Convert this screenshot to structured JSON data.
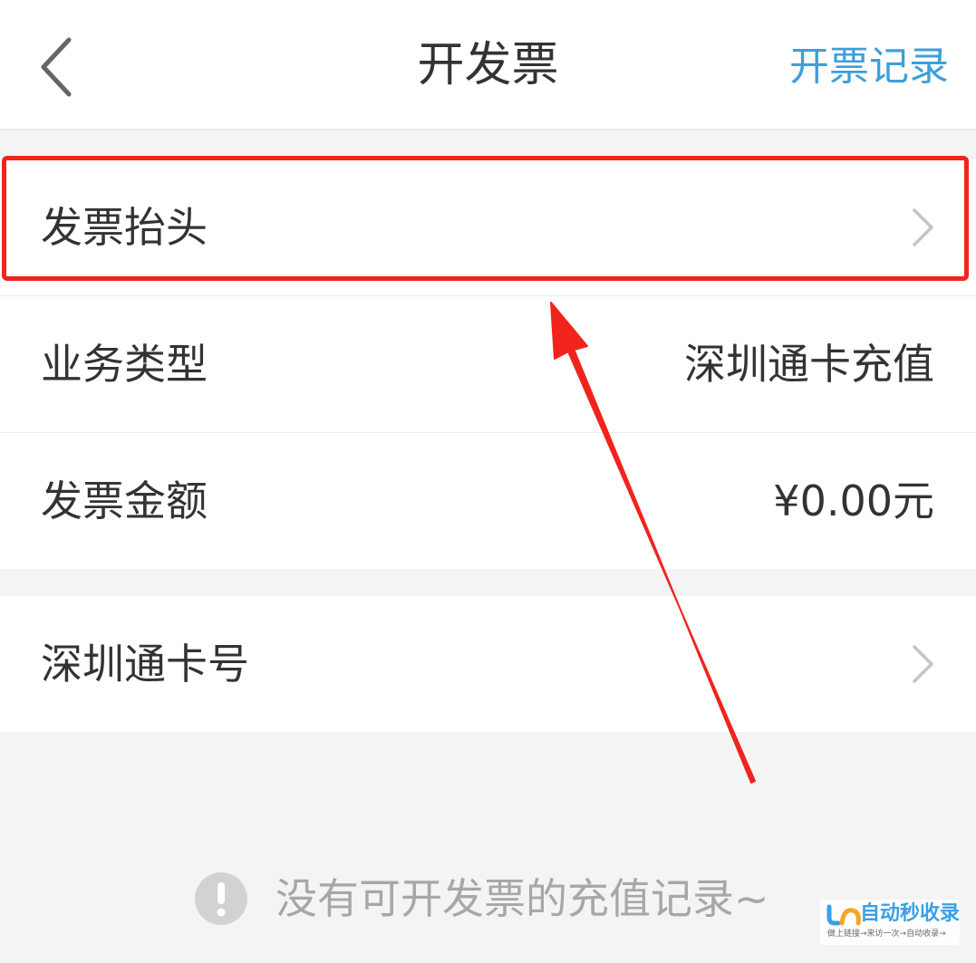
{
  "header": {
    "title": "开发票",
    "action_label": "开票记录"
  },
  "invoice_title_row": {
    "label": "发票抬头"
  },
  "info_rows": [
    {
      "label": "业务类型",
      "value": "深圳通卡充值"
    },
    {
      "label": "发票金额",
      "value": "¥0.00元"
    }
  ],
  "card_row": {
    "label": "深圳通卡号"
  },
  "empty_state": {
    "message": "没有可开发票的充值记录~",
    "icon": "exclamation-circle-icon"
  },
  "watermark": {
    "title": "自动秒收录",
    "subtitle": "做上链接→来访一次→自动收录→"
  },
  "colors": {
    "accent": "#3d9fd9",
    "annotation": "#f0241c",
    "background": "#f4f4f5",
    "muted_text": "#a7a7a7"
  }
}
